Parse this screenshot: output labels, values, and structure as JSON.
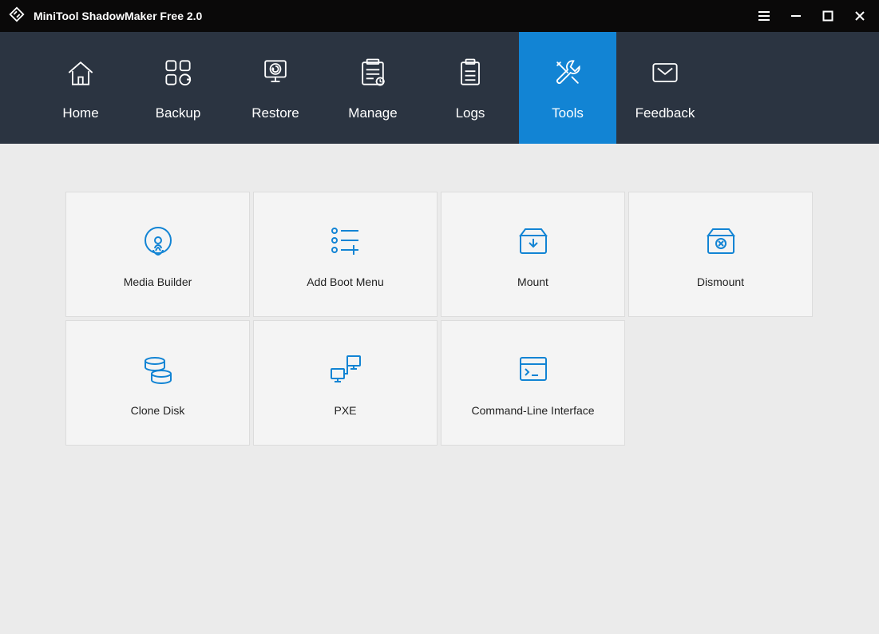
{
  "app": {
    "title": "MiniTool ShadowMaker Free 2.0"
  },
  "nav": {
    "items": [
      {
        "label": "Home"
      },
      {
        "label": "Backup"
      },
      {
        "label": "Restore"
      },
      {
        "label": "Manage"
      },
      {
        "label": "Logs"
      },
      {
        "label": "Tools"
      },
      {
        "label": "Feedback"
      }
    ],
    "active_index": 5
  },
  "tools": {
    "cards": [
      {
        "label": "Media Builder"
      },
      {
        "label": "Add Boot Menu"
      },
      {
        "label": "Mount"
      },
      {
        "label": "Dismount"
      },
      {
        "label": "Clone Disk"
      },
      {
        "label": "PXE"
      },
      {
        "label": "Command-Line Interface"
      }
    ]
  },
  "colors": {
    "accent": "#1284d4",
    "navbar": "#2b3441",
    "titlebar": "#0a0909",
    "content_bg": "#ebebeb",
    "card_bg": "#f4f4f4",
    "card_border": "#dcdcdc"
  }
}
